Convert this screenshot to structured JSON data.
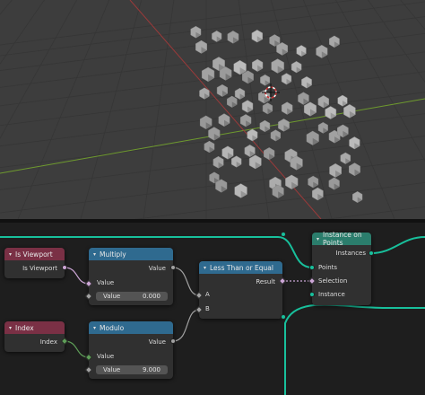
{
  "viewport": {
    "grid_color": "#393939",
    "bg": "#3d3d3d",
    "axis_x_color": "#9a3a3a",
    "axis_y_color": "#6e9a2e",
    "icon": "3d-cursor-icon"
  },
  "nodes": {
    "is_viewport": {
      "title": "Is Viewport",
      "output": "Is Viewport",
      "header_color": "#7a3045"
    },
    "index": {
      "title": "Index",
      "output": "Index",
      "header_color": "#7a3045"
    },
    "multiply": {
      "title": "Multiply",
      "output": "Value",
      "input": "Value",
      "field_label": "Value",
      "field_value": "0.000",
      "header_color": "#2f6a8f"
    },
    "modulo": {
      "title": "Modulo",
      "output": "Value",
      "input": "Value",
      "field_label": "Value",
      "field_value": "9.000",
      "header_color": "#2f6a8f"
    },
    "less_than": {
      "title": "Less Than or Equal",
      "output": "Result",
      "input_a": "A",
      "input_b": "B",
      "header_color": "#2f6a8f"
    },
    "instance_on_points": {
      "title": "Instance on Points",
      "output": "Instances",
      "input_points": "Points",
      "input_selection": "Selection",
      "input_instance": "Instance",
      "header_color": "#2b7d6c"
    }
  },
  "socket_colors": {
    "geometry": "#18c09c",
    "boolean": "#cca6d6",
    "float": "#a1a1a1",
    "integer": "#5e9e58"
  }
}
